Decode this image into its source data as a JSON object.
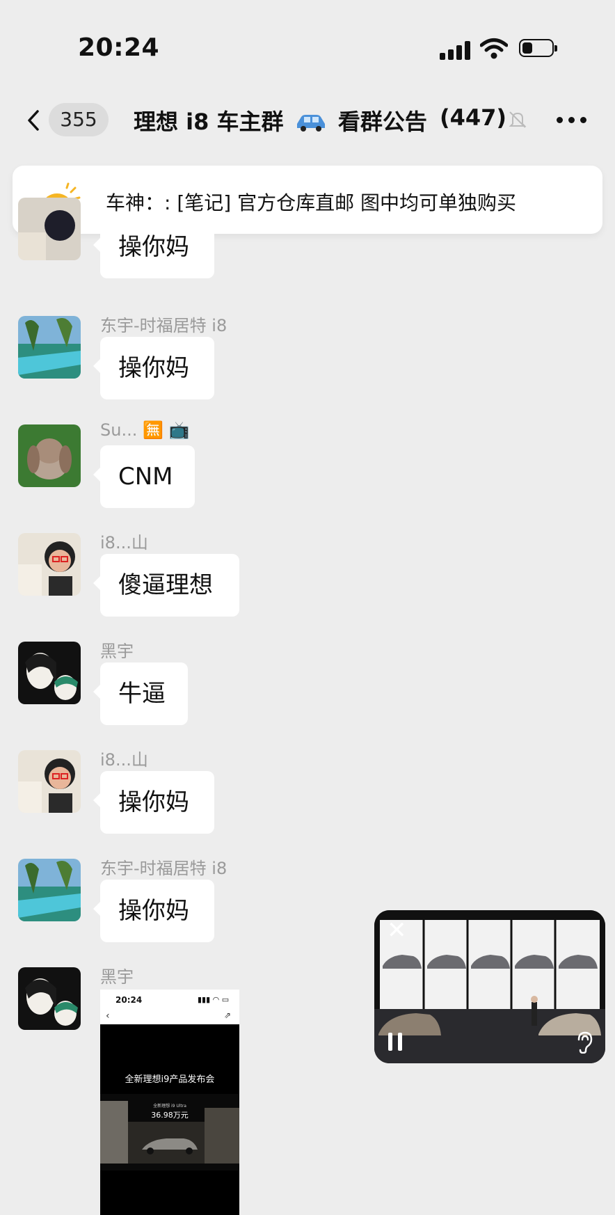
{
  "status_bar": {
    "time": "20:24",
    "battery_level": 0.35
  },
  "nav": {
    "unread_count": "355",
    "title": "理想 i8 车主群",
    "title_suffix": "看群公告",
    "member_count": "(447)"
  },
  "announcement": {
    "text": "车神：: [笔记] 官方仓库直邮  图中均可单独购买"
  },
  "messages": [
    {
      "sender": "",
      "text": "操你妈"
    },
    {
      "sender": "东宇-时福居特 i8",
      "text": "操你妈"
    },
    {
      "sender": "Su... 🈚 📺",
      "text": "CNM"
    },
    {
      "sender": "i8...山",
      "text": "傻逼理想"
    },
    {
      "sender": "黑宇",
      "text": "牛逼"
    },
    {
      "sender": "i8...山",
      "text": "操你妈"
    },
    {
      "sender": "东宇-时福居特 i8",
      "text": "操你妈"
    },
    {
      "sender": "黑宇",
      "text": ""
    }
  ],
  "shared_screenshot": {
    "time": "20:24",
    "status": "▮▮▮ ◠ ▭",
    "title": "全新理想i9产品发布会",
    "price_label": "全新理想 i9 Ultra",
    "price": "36.98万元"
  },
  "pip": {
    "close_label": "✕"
  }
}
